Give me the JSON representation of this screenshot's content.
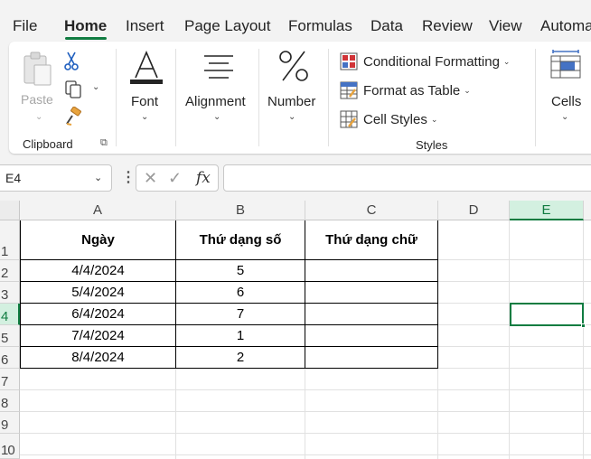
{
  "tabs": [
    "File",
    "Home",
    "Insert",
    "Page Layout",
    "Formulas",
    "Data",
    "Review",
    "View",
    "Automa"
  ],
  "ribbon": {
    "clipboard": {
      "paste_label": "Paste",
      "group_label": "Clipboard"
    },
    "font_label": "Font",
    "alignment_label": "Alignment",
    "number_label": "Number",
    "styles": {
      "conditional_formatting": "Conditional Formatting",
      "format_as_table": "Format as Table",
      "cell_styles": "Cell Styles",
      "group_label": "Styles"
    },
    "cells_label": "Cells"
  },
  "formula_bar": {
    "name_box": "E4",
    "fx_label": "fx",
    "formula": ""
  },
  "columns": [
    "A",
    "B",
    "C",
    "D",
    "E"
  ],
  "rows": [
    "1",
    "2",
    "3",
    "4",
    "5",
    "6",
    "7",
    "8",
    "9",
    "10"
  ],
  "selected": {
    "column": "E",
    "row": "4",
    "cell": "E4"
  },
  "table": {
    "headers": [
      "Ngày",
      "Thứ dạng số",
      "Thứ dạng chữ"
    ],
    "rows": [
      [
        "4/4/2024",
        "5",
        ""
      ],
      [
        "5/4/2024",
        "6",
        ""
      ],
      [
        "6/4/2024",
        "7",
        ""
      ],
      [
        "7/4/2024",
        "1",
        ""
      ],
      [
        "8/4/2024",
        "2",
        ""
      ]
    ]
  },
  "colors": {
    "accent": "#107c41",
    "selected_header_bg": "#d3f0e0"
  }
}
